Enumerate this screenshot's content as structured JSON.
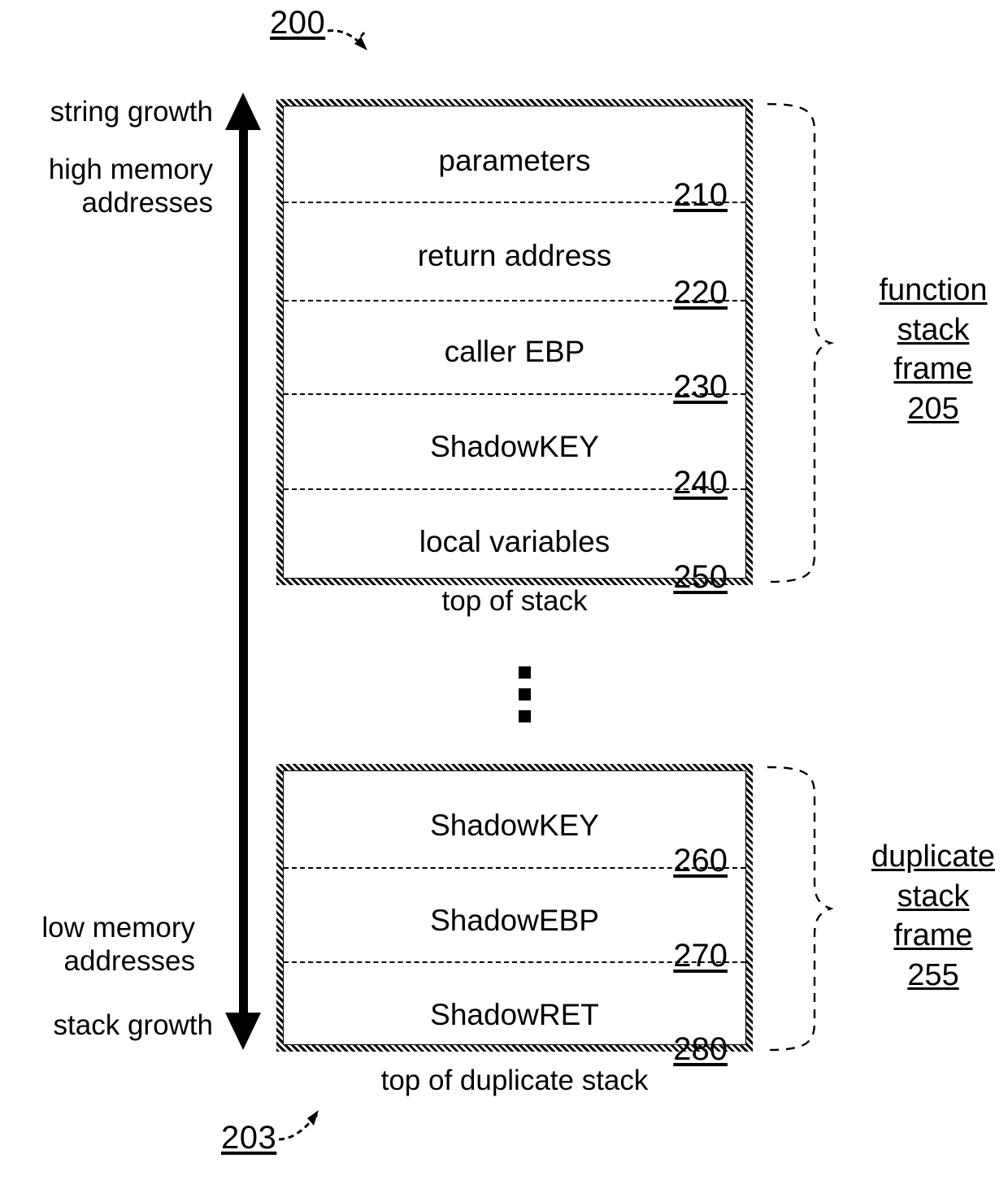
{
  "figure": {
    "top_ref": "200",
    "bottom_ref": "203"
  },
  "axis": {
    "top_labels": [
      "string growth",
      "high memory\naddresses"
    ],
    "bottom_labels": [
      "low memory\naddresses",
      "stack growth"
    ]
  },
  "function_stack_frame": {
    "rows": [
      {
        "label": "parameters",
        "ref": "210"
      },
      {
        "label": "return address",
        "ref": "220"
      },
      {
        "label": "caller EBP",
        "ref": "230"
      },
      {
        "label": "ShadowKEY",
        "ref": "240"
      },
      {
        "label": "local variables",
        "ref": "250"
      }
    ],
    "caption": "top of stack",
    "bracket_label_lines": [
      "function",
      "stack",
      "frame",
      "205"
    ]
  },
  "duplicate_stack_frame": {
    "rows": [
      {
        "label": "ShadowKEY",
        "ref": "260"
      },
      {
        "label": "ShadowEBP",
        "ref": "270"
      },
      {
        "label": "ShadowRET",
        "ref": "280"
      }
    ],
    "caption": "top of duplicate stack",
    "bracket_label_lines": [
      "duplicate",
      "stack",
      "frame",
      "255"
    ]
  },
  "ellipsis": {
    "symbol": "vertical-ellipsis",
    "dot_count": 3
  },
  "colors": {
    "ink": "#000000",
    "paper": "#ffffff"
  }
}
